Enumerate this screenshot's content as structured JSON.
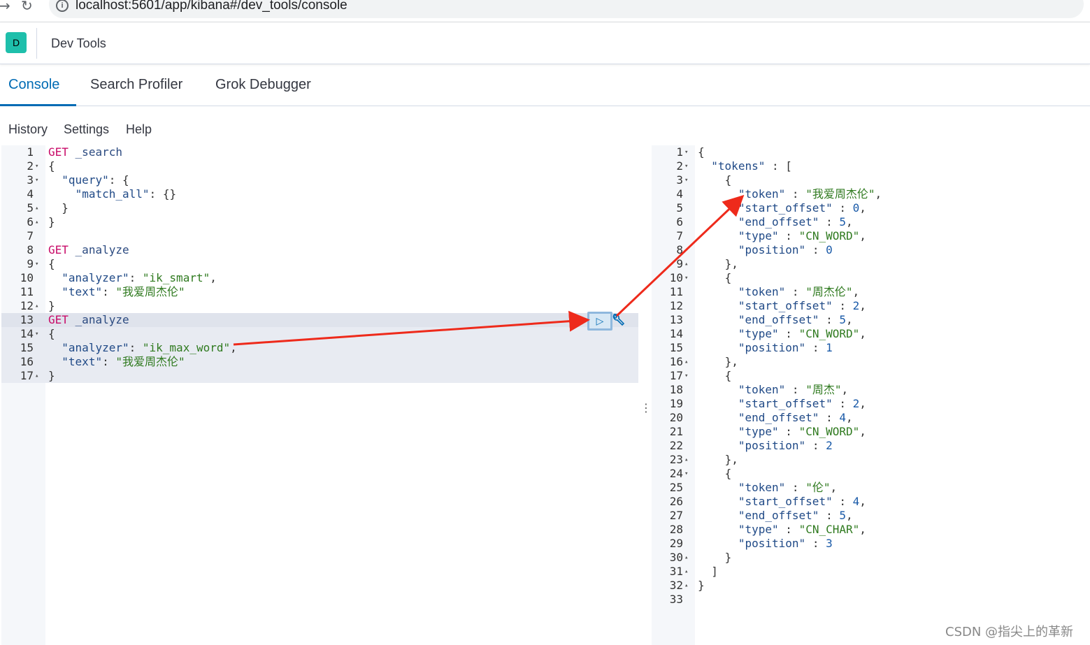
{
  "browser": {
    "back_icon": "back-arrow-icon",
    "reload_icon": "reload-icon",
    "info_icon": "info-icon",
    "url": "localhost:5601/app/kibana#/dev_tools/console"
  },
  "header": {
    "space_avatar": "D",
    "title": "Dev Tools"
  },
  "tabs": [
    {
      "label": "Console",
      "active": true
    },
    {
      "label": "Search Profiler",
      "active": false
    },
    {
      "label": "Grok Debugger",
      "active": false
    }
  ],
  "console_menu": [
    "History",
    "Settings",
    "Help"
  ],
  "request_editor": {
    "lines": [
      "GET _search",
      "{",
      "  \"query\": {",
      "    \"match_all\": {}",
      "  }",
      "}",
      "",
      "GET _analyze",
      "{",
      "  \"analyzer\": \"ik_smart\",",
      "  \"text\": \"我爱周杰伦\"",
      "}",
      "GET _analyze",
      "{",
      "  \"analyzer\": \"ik_max_word\",",
      "  \"text\": \"我爱周杰伦\"",
      "}"
    ],
    "active_line": 13
  },
  "response_viewer": {
    "lines": [
      "{",
      "  \"tokens\" : [",
      "    {",
      "      \"token\" : \"我爱周杰伦\",",
      "      \"start_offset\" : 0,",
      "      \"end_offset\" : 5,",
      "      \"type\" : \"CN_WORD\",",
      "      \"position\" : 0",
      "    },",
      "    {",
      "      \"token\" : \"周杰伦\",",
      "      \"start_offset\" : 2,",
      "      \"end_offset\" : 5,",
      "      \"type\" : \"CN_WORD\",",
      "      \"position\" : 1",
      "    },",
      "    {",
      "      \"token\" : \"周杰\",",
      "      \"start_offset\" : 2,",
      "      \"end_offset\" : 4,",
      "      \"type\" : \"CN_WORD\",",
      "      \"position\" : 2",
      "    },",
      "    {",
      "      \"token\" : \"伦\",",
      "      \"start_offset\" : 4,",
      "      \"end_offset\" : 5,",
      "      \"type\" : \"CN_CHAR\",",
      "      \"position\" : 3",
      "    }",
      "  ]",
      "}",
      ""
    ]
  },
  "actions": {
    "play_icon": "play-icon",
    "wrench_icon": "wrench-icon",
    "resize_handle": "⋮"
  },
  "annotation_color": "#ee2a1b",
  "watermark": "CSDN @指尖上的革新"
}
